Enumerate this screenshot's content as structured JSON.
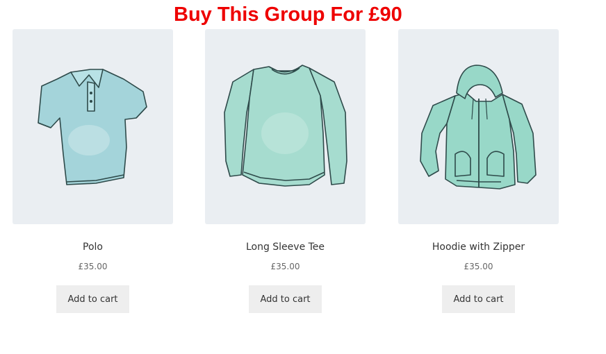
{
  "promo": {
    "heading": "Buy This Group For £90",
    "color": "#ee0000"
  },
  "products": [
    {
      "title": "Polo",
      "price": "£35.00",
      "button_label": "Add to cart",
      "image_icon": "polo-shirt-icon"
    },
    {
      "title": "Long Sleeve Tee",
      "price": "£35.00",
      "button_label": "Add to cart",
      "image_icon": "long-sleeve-tee-icon"
    },
    {
      "title": "Hoodie with Zipper",
      "price": "£35.00",
      "button_label": "Add to cart",
      "image_icon": "hoodie-icon"
    }
  ],
  "colors": {
    "image_background": "#eaeef2",
    "button_background": "#eeeeee",
    "polo_fill": "#a4d4da",
    "tee_fill": "#a6dccf",
    "hoodie_fill": "#98d8c8",
    "outline": "#2e4a4a"
  }
}
